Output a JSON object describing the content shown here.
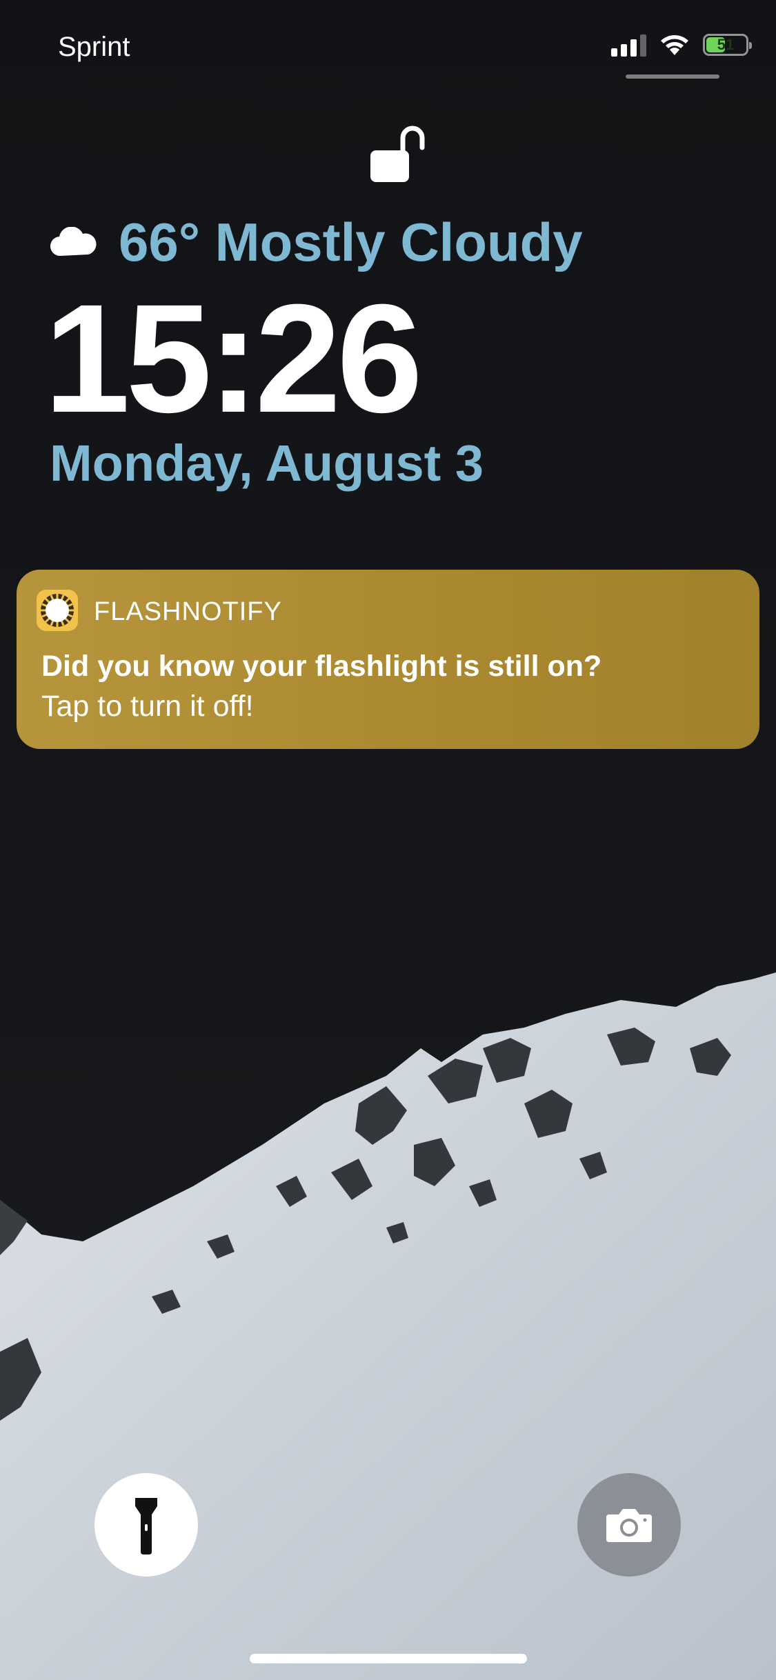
{
  "status_bar": {
    "carrier": "Sprint",
    "battery_percent": "51",
    "battery_level": 0.51,
    "signal_bars_active": 3,
    "signal_bars_total": 4,
    "icons": [
      "cellular-signal-icon",
      "wifi-icon",
      "battery-icon"
    ]
  },
  "lock": {
    "icon": "unlocked-padlock-icon"
  },
  "weather": {
    "icon": "cloud-icon",
    "text": "66° Mostly Cloudy"
  },
  "clock": {
    "time": "15:26"
  },
  "date": {
    "text": "Monday, August 3"
  },
  "notification": {
    "app_icon": "sun-icon",
    "app_name": "FLASHNOTIFY",
    "title": "Did you know your flashlight is still on?",
    "body": "Tap to turn it off!",
    "color": "#b08f35"
  },
  "quick_actions": {
    "flashlight": {
      "icon": "flashlight-icon",
      "state": "on"
    },
    "camera": {
      "icon": "camera-icon"
    }
  },
  "colors": {
    "accent_text": "#7fb8d3",
    "background": "#141518",
    "battery_fill": "#6fd35c"
  }
}
